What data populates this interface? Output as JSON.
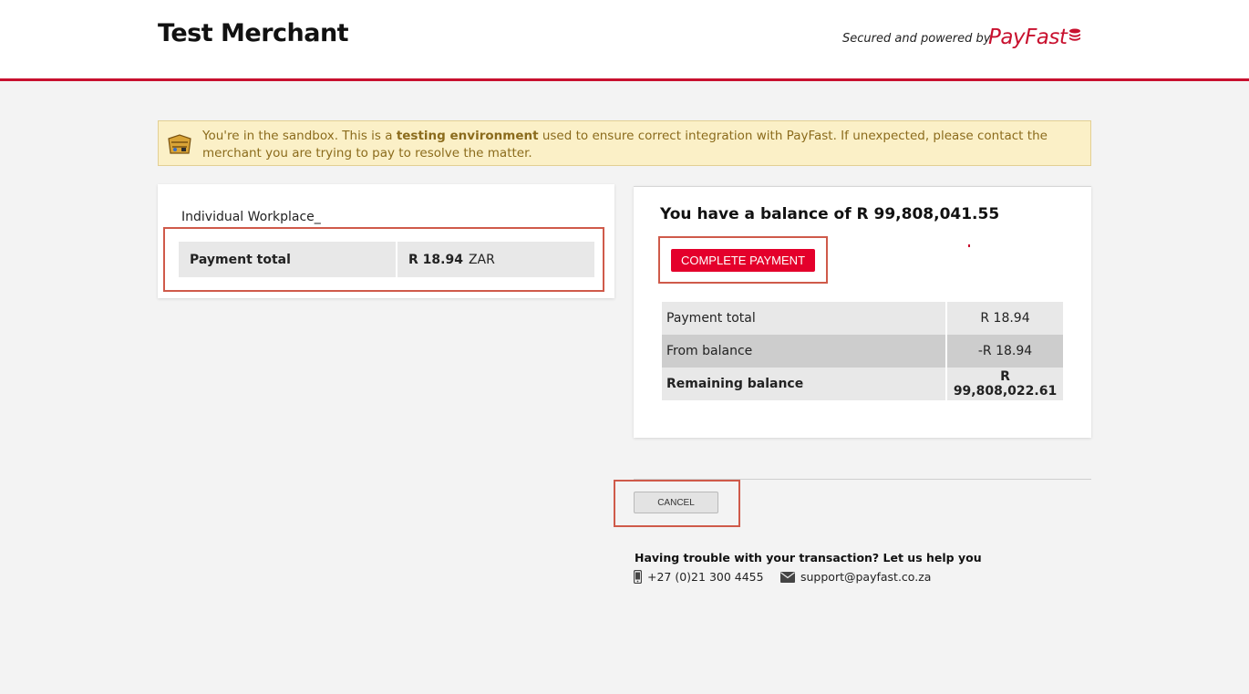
{
  "header": {
    "merchant_name": "Test Merchant",
    "secured_text": "Secured and powered by",
    "brand": "PayFast",
    "accent_color": "#c8102e"
  },
  "sandbox_notice": {
    "text_before": "You're in the sandbox. This is a ",
    "text_bold": "testing environment",
    "text_after": " used to ensure correct integration with PayFast. If unexpected, please contact the merchant you are trying to pay to resolve the matter.",
    "icon": "sandbox-icon"
  },
  "order": {
    "item_name": "Individual Workplace_",
    "payment_total_label": "Payment total",
    "payment_total_amount": "R 18.94",
    "currency": "ZAR"
  },
  "balance": {
    "title": "You have a balance of R 99,808,041.55",
    "complete_button": "COMPLETE PAYMENT",
    "rows": [
      {
        "label": "Payment total",
        "amount": "R 18.94"
      },
      {
        "label": "From balance",
        "amount": "-R 18.94"
      },
      {
        "label": "Remaining balance",
        "amount": "R 99,808,022.61"
      }
    ]
  },
  "cancel_button": "CANCEL",
  "help": {
    "title": "Having trouble with your transaction? Let us help you",
    "phone": "+27 (0)21 300 4455",
    "email": "support@payfast.co.za"
  }
}
